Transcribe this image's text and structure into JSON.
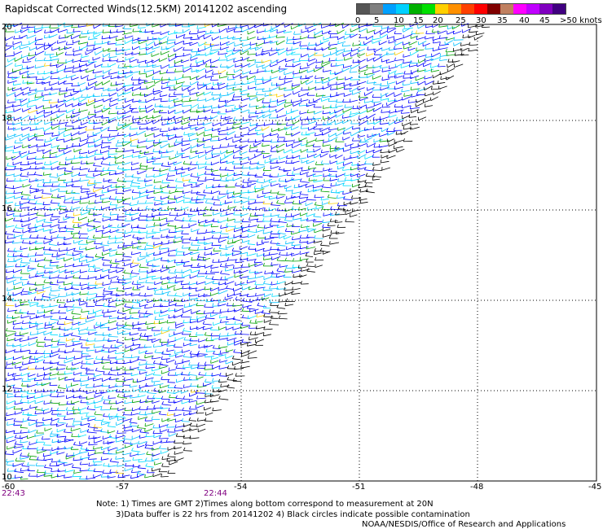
{
  "title": "Rapidscat Corrected Winds(12.5KM) 20141202 ascending",
  "legend": {
    "colors": [
      "#555555",
      "#7f7f7f",
      "#00a0ff",
      "#00d0ff",
      "#00b000",
      "#00e000",
      "#ffd000",
      "#ff9000",
      "#ff4000",
      "#ff0000",
      "#800000",
      "#c08060",
      "#ff00ff",
      "#c000ff",
      "#8000c0",
      "#400080"
    ],
    "labels": [
      "0",
      "5",
      "10",
      "15",
      "20",
      "25",
      "30",
      "35",
      "40",
      "45",
      ">50 knots"
    ]
  },
  "map": {
    "lon_labels": [
      "-60",
      "-57",
      "-54",
      "-51",
      "-48",
      "-45"
    ],
    "lat_labels": [
      "20",
      "18",
      "16",
      "14",
      "12",
      "10"
    ],
    "time_labels": [
      "22:43",
      "22:44"
    ],
    "barb_colors": {
      "calm": "#00c0ff",
      "light": "#00e0ff",
      "moderate": "#0000ff",
      "fresh": "#00a000",
      "strong": "#ffd000",
      "flagged": "#000000"
    }
  },
  "notes": {
    "line1": "Note: 1) Times are GMT 2)Times along bottom correspond to measurement at 20N",
    "line2": "3)Data buffer is 22 hrs from 20141202 4) Black circles indicate possible contamination",
    "line3": "NOAA/NESDIS/Office of Research and Applications"
  }
}
